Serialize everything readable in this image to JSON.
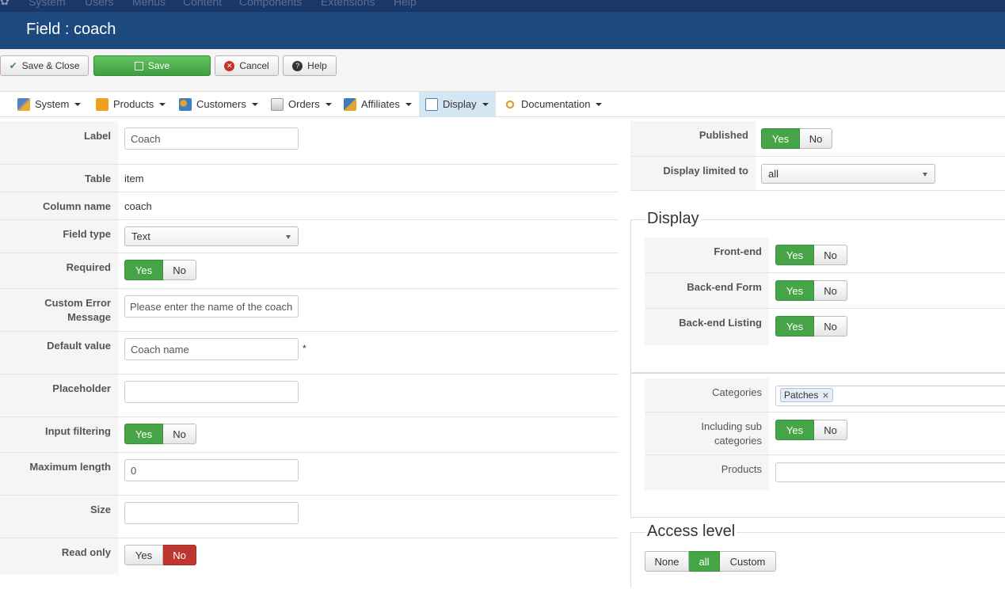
{
  "topmenu": [
    "System",
    "Users",
    "Menus",
    "Content",
    "Components",
    "Extensions",
    "Help"
  ],
  "title": "Field : coach",
  "toolbar": {
    "save_close": "Save & Close",
    "save": "Save",
    "cancel": "Cancel",
    "help": "Help"
  },
  "nav": [
    "System",
    "Products",
    "Customers",
    "Orders",
    "Affiliates",
    "Display",
    "Documentation"
  ],
  "form": {
    "label": {
      "label": "Label",
      "value": "Coach"
    },
    "table": {
      "label": "Table",
      "value": "item"
    },
    "column": {
      "label": "Column name",
      "value": "coach"
    },
    "fieldtype": {
      "label": "Field type",
      "value": "Text"
    },
    "required": {
      "label": "Required",
      "yes": "Yes",
      "no": "No"
    },
    "error": {
      "label_line1": "Custom Error",
      "label_line2": "Message",
      "value": "Please enter the name of the coach"
    },
    "default": {
      "label": "Default value",
      "value": "Coach name",
      "star": "*"
    },
    "placeholder": {
      "label": "Placeholder",
      "value": ""
    },
    "filtering": {
      "label": "Input filtering",
      "yes": "Yes",
      "no": "No"
    },
    "maxlength": {
      "label": "Maximum length",
      "value": "0"
    },
    "size": {
      "label": "Size",
      "value": ""
    },
    "readonly": {
      "label": "Read only",
      "yes": "Yes",
      "no": "No"
    }
  },
  "right": {
    "published": {
      "label": "Published",
      "yes": "Yes",
      "no": "No"
    },
    "limited": {
      "label": "Display limited to",
      "value": "all"
    },
    "display_legend": "Display",
    "frontend": {
      "label": "Front-end",
      "yes": "Yes",
      "no": "No"
    },
    "backform": {
      "label": "Back-end Form",
      "yes": "Yes",
      "no": "No"
    },
    "backlist": {
      "label": "Back-end Listing",
      "yes": "Yes",
      "no": "No"
    },
    "categories": {
      "label": "Categories",
      "tag": "Patches",
      "remove": "×"
    },
    "subcats": {
      "label_line1": "Including sub",
      "label_line2": "categories",
      "yes": "Yes",
      "no": "No"
    },
    "products": {
      "label": "Products",
      "value": ""
    },
    "access_legend": "Access level",
    "access": {
      "none": "None",
      "all": "all",
      "custom": "Custom"
    }
  },
  "colors": {
    "topmenu": "#1a3867",
    "titlebar": "#1c4a7e",
    "green": "#46a546",
    "red": "#bd362f",
    "active_nav": "#d5e6f3"
  }
}
